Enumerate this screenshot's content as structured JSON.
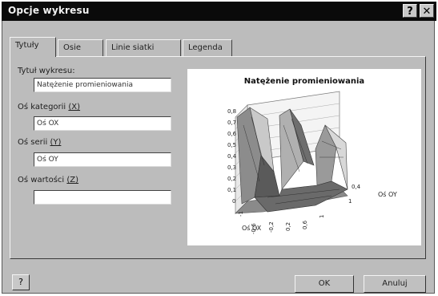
{
  "window": {
    "title": "Opcje wykresu",
    "help_glyph": "?",
    "close_glyph": "✕"
  },
  "tabs": [
    {
      "label": "Tytuły",
      "active": true
    },
    {
      "label": "Osie",
      "active": false
    },
    {
      "label": "Linie siatki",
      "active": false
    },
    {
      "label": "Legenda",
      "active": false
    }
  ],
  "fields": {
    "chart_title": {
      "label": "Tytuł wykresu:",
      "value": "Natężenie promieniowania"
    },
    "category_axis": {
      "label_text": "Oś kategorii ",
      "hotkey": "(X)",
      "value": "Oś OX"
    },
    "series_axis": {
      "label_text": "Oś serii ",
      "hotkey": "(Y)",
      "value": "Oś OY"
    },
    "value_axis": {
      "label_text": "Oś wartości ",
      "hotkey": "(Z)",
      "value": ""
    }
  },
  "preview": {
    "title": "Natężenie promieniowania",
    "z_ticks": [
      "0,8",
      "0,7",
      "0,6",
      "0,5",
      "0,4",
      "0,3",
      "0,2",
      "0,1",
      "0"
    ],
    "x_ticks": [
      "-1",
      "-0,6",
      "-0,2",
      "0,2",
      "0,6",
      "1"
    ],
    "x_axis_label": "Oś OX",
    "y_tick_top": "0,4",
    "y_tick_bottom": "1",
    "y_axis_label": "Oś OY"
  },
  "buttons": {
    "ok": "OK",
    "cancel": "Anuluj",
    "help": "?"
  }
}
